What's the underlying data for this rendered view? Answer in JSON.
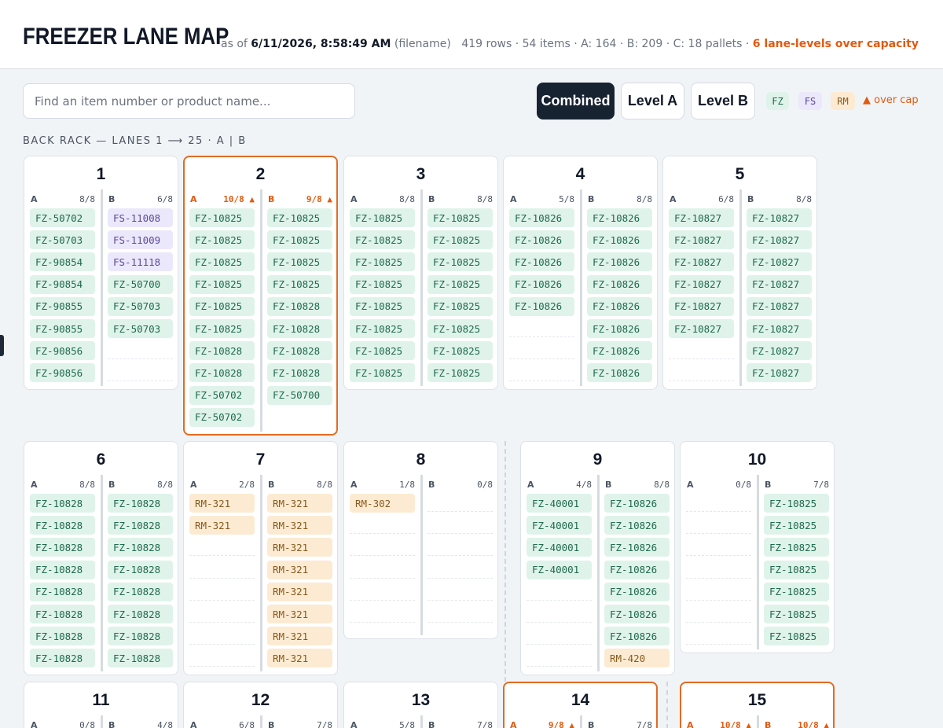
{
  "header": {
    "title": "FREEZER LANE MAP",
    "as_of_prefix": "as of",
    "timestamp": "6/11/2026, 8:58:49 AM",
    "source": "(filename)",
    "stats": "419 rows · 54 items · A: 164 · B: 209 · C: 18 pallets ·",
    "over_capacity": "6 lane-levels over capacity"
  },
  "search": {
    "placeholder": "Find an item number or product name..."
  },
  "views": [
    "Combined",
    "Level A",
    "Level B"
  ],
  "active_view": "Combined",
  "legend": [
    "FZ",
    "FS",
    "RM"
  ],
  "legend_over": "▲ over cap",
  "section_label": "BACK RACK — LANES 1 ⟶ 25 · A | B",
  "colors": {
    "over": "#e05a10",
    "FZ": "#dff3ea",
    "FS": "#ece8fb",
    "RM": "#fcebd2",
    "active": "#182332"
  },
  "lanes": [
    {
      "num": "1",
      "over": false,
      "A": {
        "label": "A",
        "count": "8/8",
        "items": [
          "FZ-50702",
          "FZ-50703",
          "FZ-90854",
          "FZ-90854",
          "FZ-90855",
          "FZ-90855",
          "FZ-90856",
          "FZ-90856"
        ]
      },
      "B": {
        "label": "B",
        "count": "6/8",
        "items": [
          "FS-11008",
          "FS-11009",
          "FS-11118",
          "FZ-50700",
          "FZ-50703",
          "FZ-50703"
        ]
      }
    },
    {
      "num": "2",
      "over": true,
      "A": {
        "label": "A",
        "count": "10/8 ▲",
        "over": true,
        "items": [
          "FZ-10825",
          "FZ-10825",
          "FZ-10825",
          "FZ-10825",
          "FZ-10825",
          "FZ-10825",
          "FZ-10828",
          "FZ-10828",
          "FZ-50702",
          "FZ-50702"
        ]
      },
      "B": {
        "label": "B",
        "count": "9/8 ▲",
        "over": true,
        "items": [
          "FZ-10825",
          "FZ-10825",
          "FZ-10825",
          "FZ-10825",
          "FZ-10828",
          "FZ-10828",
          "FZ-10828",
          "FZ-10828",
          "FZ-50700"
        ]
      }
    },
    {
      "num": "3",
      "over": false,
      "A": {
        "label": "A",
        "count": "8/8",
        "items": [
          "FZ-10825",
          "FZ-10825",
          "FZ-10825",
          "FZ-10825",
          "FZ-10825",
          "FZ-10825",
          "FZ-10825",
          "FZ-10825"
        ]
      },
      "B": {
        "label": "B",
        "count": "8/8",
        "items": [
          "FZ-10825",
          "FZ-10825",
          "FZ-10825",
          "FZ-10825",
          "FZ-10825",
          "FZ-10825",
          "FZ-10825",
          "FZ-10825"
        ]
      }
    },
    {
      "num": "4",
      "over": false,
      "A": {
        "label": "A",
        "count": "5/8",
        "items": [
          "FZ-10826",
          "FZ-10826",
          "FZ-10826",
          "FZ-10826",
          "FZ-10826"
        ]
      },
      "B": {
        "label": "B",
        "count": "8/8",
        "items": [
          "FZ-10826",
          "FZ-10826",
          "FZ-10826",
          "FZ-10826",
          "FZ-10826",
          "FZ-10826",
          "FZ-10826",
          "FZ-10826"
        ]
      }
    },
    {
      "num": "5",
      "over": false,
      "A": {
        "label": "A",
        "count": "6/8",
        "items": [
          "FZ-10827",
          "FZ-10827",
          "FZ-10827",
          "FZ-10827",
          "FZ-10827",
          "FZ-10827"
        ]
      },
      "B": {
        "label": "B",
        "count": "8/8",
        "items": [
          "FZ-10827",
          "FZ-10827",
          "FZ-10827",
          "FZ-10827",
          "FZ-10827",
          "FZ-10827",
          "FZ-10827",
          "FZ-10827"
        ]
      }
    },
    {
      "num": "6",
      "over": false,
      "A": {
        "label": "A",
        "count": "8/8",
        "items": [
          "FZ-10828",
          "FZ-10828",
          "FZ-10828",
          "FZ-10828",
          "FZ-10828",
          "FZ-10828",
          "FZ-10828",
          "FZ-10828"
        ]
      },
      "B": {
        "label": "B",
        "count": "8/8",
        "items": [
          "FZ-10828",
          "FZ-10828",
          "FZ-10828",
          "FZ-10828",
          "FZ-10828",
          "FZ-10828",
          "FZ-10828",
          "FZ-10828"
        ]
      }
    },
    {
      "num": "7",
      "over": false,
      "A": {
        "label": "A",
        "count": "2/8",
        "items": [
          "RM-321",
          "RM-321"
        ]
      },
      "B": {
        "label": "B",
        "count": "8/8",
        "items": [
          "RM-321",
          "RM-321",
          "RM-321",
          "RM-321",
          "RM-321",
          "RM-321",
          "RM-321",
          "RM-321"
        ]
      }
    },
    {
      "num": "8",
      "over": false,
      "A": {
        "label": "A",
        "count": "1/8",
        "items": [
          "RM-302"
        ]
      },
      "B": {
        "label": "B",
        "count": "0/8",
        "items": []
      }
    },
    {
      "num": "9",
      "over": false,
      "A": {
        "label": "A",
        "count": "4/8",
        "items": [
          "FZ-40001",
          "FZ-40001",
          "FZ-40001",
          "FZ-40001"
        ]
      },
      "B": {
        "label": "B",
        "count": "8/8",
        "items": [
          "FZ-10826",
          "FZ-10826",
          "FZ-10826",
          "FZ-10826",
          "FZ-10826",
          "FZ-10826",
          "FZ-10826",
          "RM-420"
        ]
      }
    },
    {
      "num": "10",
      "over": false,
      "A": {
        "label": "A",
        "count": "0/8",
        "items": []
      },
      "B": {
        "label": "B",
        "count": "7/8",
        "items": [
          "FZ-10825",
          "FZ-10825",
          "FZ-10825",
          "FZ-10825",
          "FZ-10825",
          "FZ-10825",
          "FZ-10825"
        ]
      }
    },
    {
      "num": "11",
      "over": false,
      "A": {
        "label": "A",
        "count": "0/8",
        "items": []
      },
      "B": {
        "label": "B",
        "count": "4/8",
        "items": []
      }
    },
    {
      "num": "12",
      "over": false,
      "A": {
        "label": "A",
        "count": "6/8",
        "items": []
      },
      "B": {
        "label": "B",
        "count": "7/8",
        "items": []
      }
    },
    {
      "num": "13",
      "over": false,
      "A": {
        "label": "A",
        "count": "5/8",
        "items": []
      },
      "B": {
        "label": "B",
        "count": "7/8",
        "items": []
      }
    },
    {
      "num": "14",
      "over": true,
      "A": {
        "label": "A",
        "count": "9/8 ▲",
        "over": true,
        "items": []
      },
      "B": {
        "label": "B",
        "count": "7/8",
        "items": []
      }
    },
    {
      "num": "15",
      "over": true,
      "A": {
        "label": "A",
        "count": "10/8 ▲",
        "over": true,
        "items": []
      },
      "B": {
        "label": "B",
        "count": "10/8 ▲",
        "over": true,
        "items": []
      }
    }
  ]
}
